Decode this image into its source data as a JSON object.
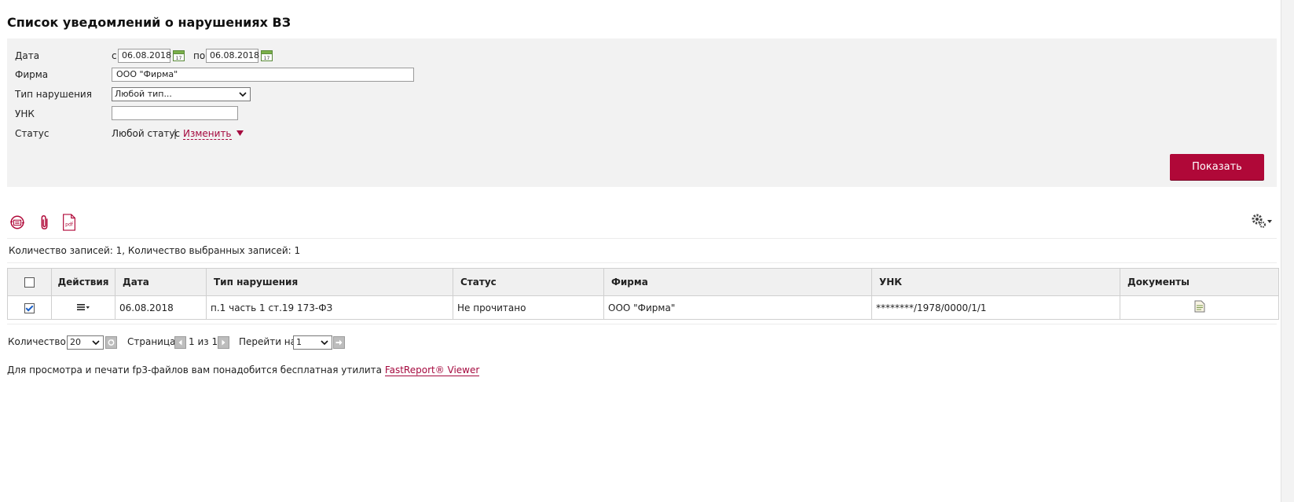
{
  "page": {
    "title": "Список уведомлений о нарушениях ВЗ"
  },
  "filters": {
    "date_label": "Дата",
    "from_prefix": "с",
    "date_from": "06.08.2018",
    "to_prefix": "по",
    "date_to": "06.08.2018",
    "firm_label": "Фирма",
    "firm_value": "ООО \"Фирма\"",
    "violation_type_label": "Тип нарушения",
    "violation_type_value": "Любой тип...",
    "unk_label": "УНК",
    "unk_value": "",
    "status_label": "Статус",
    "status_value": "Любой статус",
    "status_separator": "|",
    "change_link": "Изменить",
    "show_button": "Показать"
  },
  "toolbar": {
    "icons": [
      "refresh-icon",
      "paperclip-icon",
      "pdf-icon",
      "gear-icon"
    ],
    "pdf_text": "pdf"
  },
  "records": {
    "summary": "Количество записей: 1, Количество выбранных записей: 1"
  },
  "table": {
    "columns": [
      "",
      "Действия",
      "Дата",
      "Тип нарушения",
      "Статус",
      "Фирма",
      "УНК",
      "Документы"
    ],
    "rows": [
      {
        "checked": true,
        "date": "06.08.2018",
        "type": "п.1 часть 1 ст.19 173-ФЗ",
        "status": "Не прочитано",
        "firm": "ООО \"Фирма\"",
        "unk": "********/1978/0000/1/1"
      }
    ]
  },
  "pager": {
    "count_label": "Количество:",
    "count_value": "20",
    "page_label": "Страница:",
    "page_text": "1 из 1",
    "goto_label": "Перейти на:",
    "goto_value": "1"
  },
  "footer": {
    "text": "Для просмотра и печати fp3-файлов вам понадобится бесплатная утилита",
    "link": "FastReport® Viewer"
  },
  "colors": {
    "accent": "#b00838",
    "link": "#a5093e",
    "panel": "#f2f2f2"
  }
}
